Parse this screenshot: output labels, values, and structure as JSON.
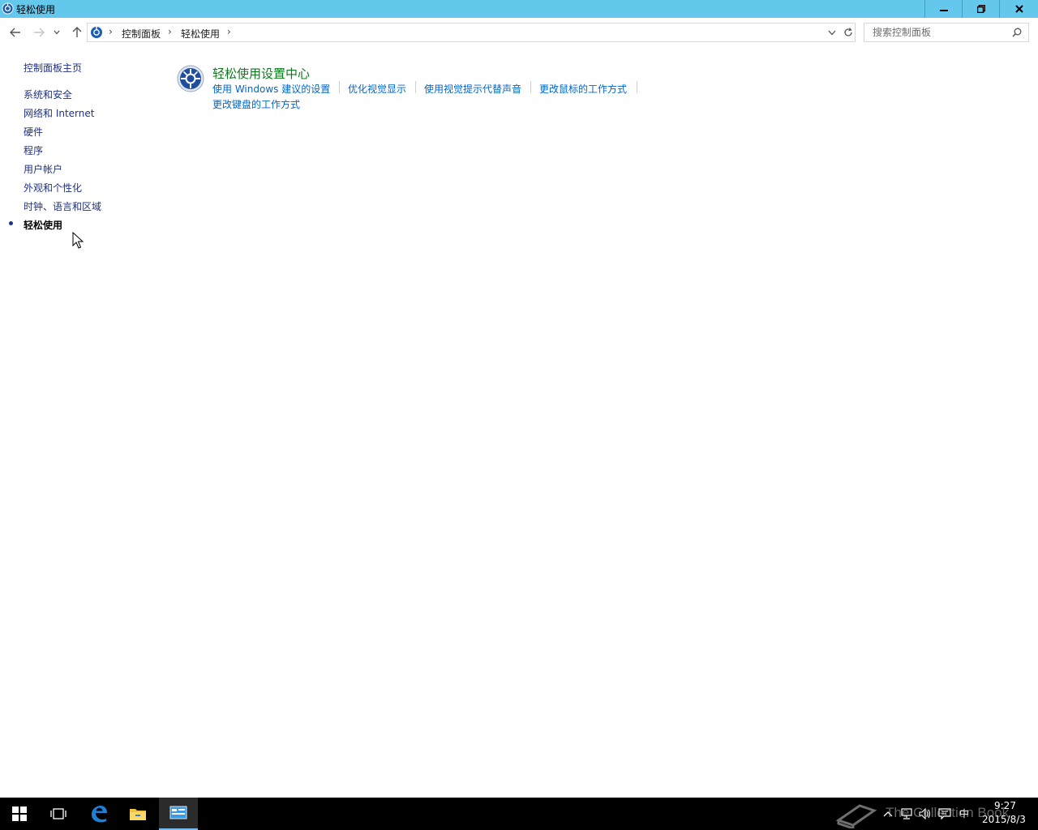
{
  "window": {
    "title": "轻松使用"
  },
  "address": {
    "breadcrumbs": [
      "控制面板",
      "轻松使用"
    ],
    "search_placeholder": "搜索控制面板"
  },
  "sidebar": {
    "home": "控制面板主页",
    "items": [
      {
        "label": "系统和安全"
      },
      {
        "label": "网络和 Internet"
      },
      {
        "label": "硬件"
      },
      {
        "label": "程序"
      },
      {
        "label": "用户帐户"
      },
      {
        "label": "外观和个性化"
      },
      {
        "label": "时钟、语言和区域"
      },
      {
        "label": "轻松使用",
        "current": true
      }
    ]
  },
  "main": {
    "section_title": "轻松使用设置中心",
    "icon": "ease-of-access-icon",
    "tasks": [
      "使用 Windows 建议的设置",
      "优化视觉显示",
      "使用视觉提示代替声音",
      "更改鼠标的工作方式",
      "更改键盘的工作方式"
    ]
  },
  "taskbar": {
    "ime": "中",
    "time": "9:27",
    "date": "2015/8/3",
    "watermark": "The Collection Book"
  },
  "colors": {
    "titlebar": "#63c8ec",
    "link": "#0066cc",
    "sidebar_link": "#1e3287",
    "section_title": "#0c7a1c",
    "taskbar": "#000000"
  }
}
